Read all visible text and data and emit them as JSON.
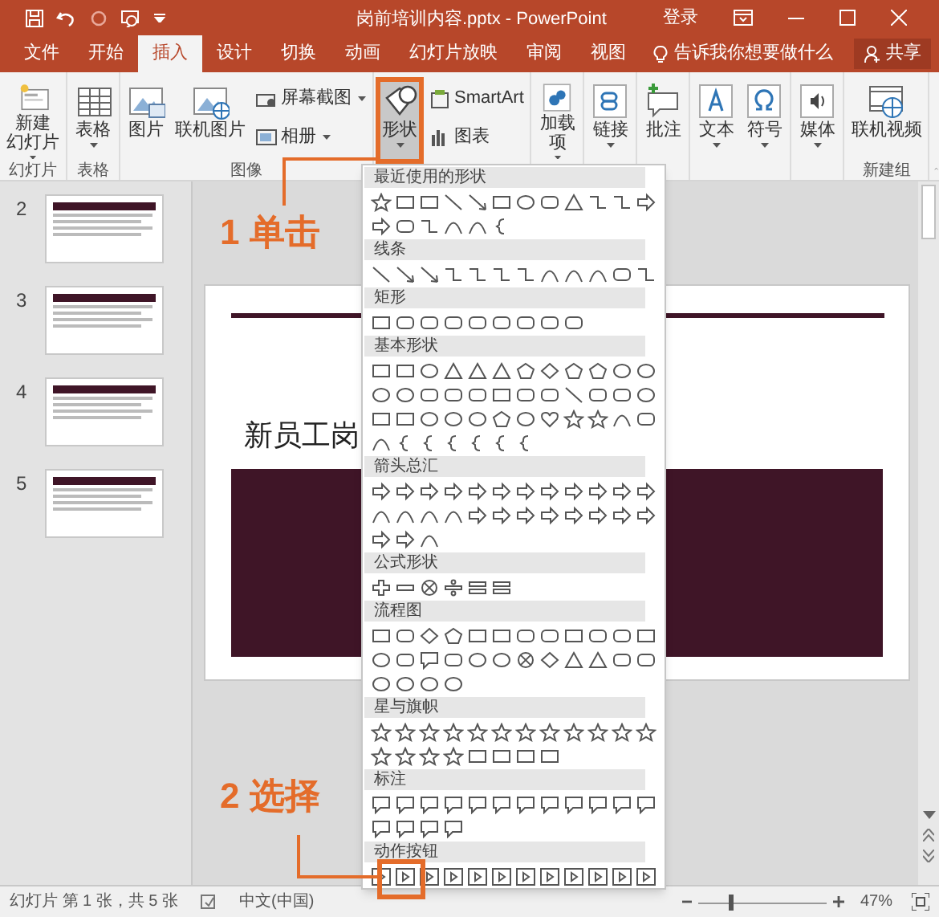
{
  "window": {
    "title": "岗前培训内容.pptx - PowerPoint",
    "sign_in": "登录"
  },
  "tabs": [
    {
      "label": "文件",
      "selected": false
    },
    {
      "label": "开始",
      "selected": false
    },
    {
      "label": "插入",
      "selected": true
    },
    {
      "label": "设计",
      "selected": false
    },
    {
      "label": "切换",
      "selected": false
    },
    {
      "label": "动画",
      "selected": false
    },
    {
      "label": "幻灯片放映",
      "selected": false
    },
    {
      "label": "审阅",
      "selected": false
    },
    {
      "label": "视图",
      "selected": false
    }
  ],
  "tell_me": {
    "placeholder": "告诉我你想要做什么"
  },
  "share": "共享",
  "ribbon": {
    "groups": [
      {
        "label": "幻灯片",
        "items": [
          {
            "label": [
              "新建",
              "幻灯片"
            ],
            "kind": "large",
            "dropdown": true,
            "selected": false
          }
        ]
      },
      {
        "label": "表格",
        "items": [
          {
            "label": "表格",
            "kind": "large",
            "dropdown": true,
            "selected": false
          }
        ]
      },
      {
        "label": "图像",
        "items": [
          {
            "label": "图片",
            "kind": "large",
            "dropdown": false,
            "selected": false
          },
          {
            "label": "联机图片",
            "kind": "large",
            "dropdown": false,
            "selected": false
          },
          {
            "label": "屏幕截图",
            "kind": "small",
            "dropdown": true,
            "selected": false
          },
          {
            "label": "相册",
            "kind": "small",
            "dropdown": true,
            "selected": false
          }
        ]
      },
      {
        "items": [
          {
            "label": "形状",
            "kind": "large",
            "dropdown": true,
            "selected": true
          },
          {
            "label": "SmartArt",
            "kind": "small",
            "dropdown": false,
            "selected": false
          },
          {
            "label": "图表",
            "kind": "small",
            "dropdown": false,
            "selected": false
          }
        ]
      },
      {
        "items": [
          {
            "label": [
              "加载",
              "项"
            ],
            "kind": "large",
            "dropdown": true,
            "selected": false
          }
        ]
      },
      {
        "items": [
          {
            "label": "链接",
            "kind": "large",
            "dropdown": true,
            "selected": false
          }
        ]
      },
      {
        "items": [
          {
            "label": "批注",
            "kind": "large",
            "dropdown": false,
            "selected": false
          }
        ]
      },
      {
        "items": [
          {
            "label": "文本",
            "kind": "large",
            "dropdown": true,
            "selected": false
          },
          {
            "label": "符号",
            "kind": "large",
            "dropdown": true,
            "selected": false
          }
        ]
      },
      {
        "items": [
          {
            "label": "媒体",
            "kind": "large",
            "dropdown": true,
            "selected": false
          }
        ]
      },
      {
        "label": "新建组",
        "items": [
          {
            "label": "联机视频",
            "kind": "large",
            "dropdown": false,
            "selected": false
          }
        ]
      }
    ]
  },
  "thumbnails": [
    {
      "number": "2"
    },
    {
      "number": "3"
    },
    {
      "number": "4"
    },
    {
      "number": "5"
    }
  ],
  "slide": {
    "title": "新员工岗"
  },
  "shapes_menu": {
    "sections": [
      {
        "title": "最近使用的形状"
      },
      {
        "title": "线条"
      },
      {
        "title": "矩形"
      },
      {
        "title": "基本形状"
      },
      {
        "title": "箭头总汇"
      },
      {
        "title": "公式形状"
      },
      {
        "title": "流程图"
      },
      {
        "title": "星与旗帜"
      },
      {
        "title": "标注"
      },
      {
        "title": "动作按钮"
      }
    ]
  },
  "callouts": [
    {
      "number": "1",
      "text": "单击"
    },
    {
      "number": "2",
      "text": "选择"
    }
  ],
  "status_bar": {
    "slide_info": "幻灯片 第 1 张，共 5 张",
    "language": "中文(中国)",
    "zoom": {
      "level": 0.26,
      "reading": "47%"
    }
  }
}
